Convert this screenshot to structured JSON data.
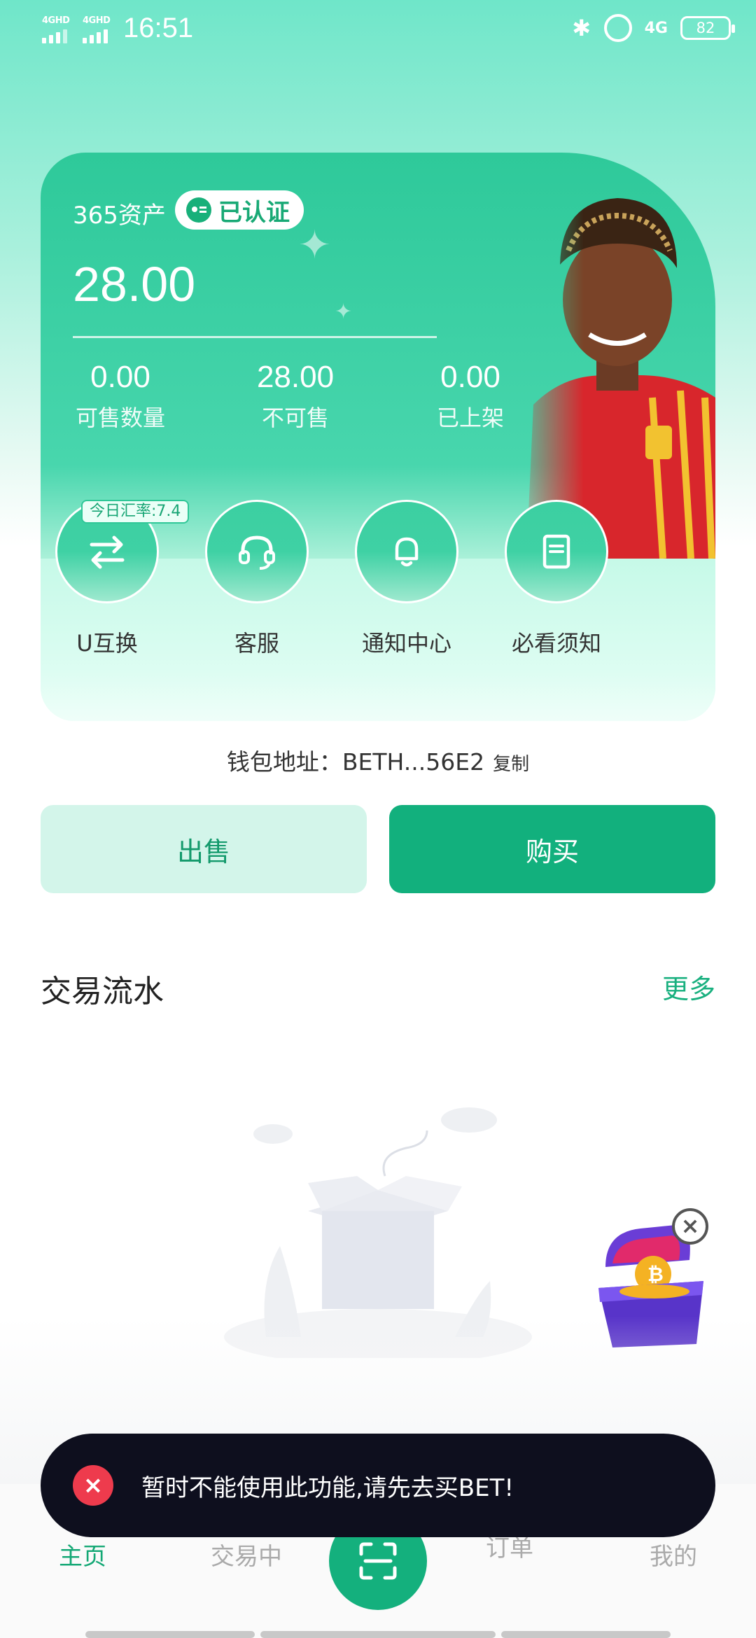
{
  "status_bar": {
    "signal1": "4GHD",
    "signal2": "4GHD",
    "time": "16:51",
    "network": "4G",
    "battery": "82",
    "icons": [
      "bluetooth-icon",
      "alarm-icon"
    ]
  },
  "asset_card": {
    "label": "365资产",
    "verified": "已认证",
    "balance": "28.00",
    "stats": [
      {
        "value": "0.00",
        "label": "可售数量"
      },
      {
        "value": "28.00",
        "label": "不可售"
      },
      {
        "value": "0.00",
        "label": "已上架"
      }
    ],
    "rate_tag": "今日汇率:7.4",
    "actions": [
      {
        "label": "U互换",
        "icon": "exchange-icon"
      },
      {
        "label": "客服",
        "icon": "headset-icon"
      },
      {
        "label": "通知中心",
        "icon": "bell-icon"
      },
      {
        "label": "必看须知",
        "icon": "notebook-icon"
      }
    ]
  },
  "wallet": {
    "label": "钱包地址：",
    "address": "BETH...56E2",
    "copy": "复制"
  },
  "buttons": {
    "sell": "出售",
    "buy": "购买"
  },
  "transactions": {
    "title": "交易流水",
    "more": "更多"
  },
  "toast": {
    "message": "暂时不能使用此功能,请先去买BET!"
  },
  "tabbar": {
    "home": "主页",
    "trading": "交易中",
    "orders": "订单",
    "mine": "我的"
  },
  "colors": {
    "accent": "#14b07d",
    "toast_bg": "#0e0f1e",
    "error": "#ee3b4d"
  }
}
